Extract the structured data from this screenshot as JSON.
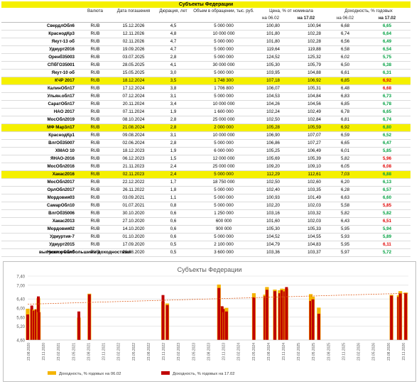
{
  "title": "Субъекты Федерации",
  "headers": {
    "currency": "Валюта",
    "maturity": "Дата погашения",
    "duration": "Дюрация, лет",
    "volume": "Объем в обращении, тыс. руб.",
    "price": "Цена, % от номинала",
    "yield": "Доходность, % годовых",
    "price_0602": "на 06.02",
    "price_1702": "на 17.02",
    "yield_0602": "на 06.02",
    "yield_1702": "на 17.02"
  },
  "colors": {
    "highlight": "#f5f000",
    "up": "#00a040",
    "down": "#e00000",
    "bar_0602": "#f4b400",
    "bar_1702": "#c00000",
    "trend": "#e06020"
  },
  "rows": [
    {
      "name": "СвердлОбл6",
      "cur": "RUB",
      "date": "15.12.2026",
      "dur": "4,5",
      "vol": "5 000 000",
      "p1": "100,80",
      "p2": "100,94",
      "y1": "6,68",
      "y2": "6,65",
      "dir": "up",
      "hl": false
    },
    {
      "name": "КраснодКр3",
      "cur": "RUB",
      "date": "12.11.2026",
      "dur": "4,8",
      "vol": "10 000 000",
      "p1": "101,80",
      "p2": "102,28",
      "y1": "6,74",
      "y2": "6,64",
      "dir": "up",
      "hl": false
    },
    {
      "name": "Якут-13 об",
      "cur": "RUB",
      "date": "02.11.2026",
      "dur": "4,7",
      "vol": "5 000 000",
      "p1": "101,80",
      "p2": "102,28",
      "y1": "6,56",
      "y2": "6,49",
      "dir": "up",
      "hl": false
    },
    {
      "name": "Удмурт2016",
      "cur": "RUB",
      "date": "19.09.2026",
      "dur": "4,7",
      "vol": "5 000 000",
      "p1": "119,64",
      "p2": "119,88",
      "y1": "6,58",
      "y2": "6,54",
      "dir": "up",
      "hl": false
    },
    {
      "name": "Оренб35003",
      "cur": "RUB",
      "date": "03.07.2025",
      "dur": "2,8",
      "vol": "5 000 000",
      "p1": "124,52",
      "p2": "125,32",
      "y1": "6,02",
      "y2": "5,75",
      "dir": "up",
      "hl": false
    },
    {
      "name": "СПбГО35001",
      "cur": "RUB",
      "date": "28.05.2025",
      "dur": "4,1",
      "vol": "30 000 000",
      "p1": "105,30",
      "p2": "105,79",
      "y1": "6,50",
      "y2": "6,38",
      "dir": "up",
      "hl": false
    },
    {
      "name": "Якут-10 об",
      "cur": "RUB",
      "date": "15.05.2025",
      "dur": "3,0",
      "vol": "5 000 000",
      "p1": "103,95",
      "p2": "104,88",
      "y1": "6,61",
      "y2": "6,31",
      "dir": "up",
      "hl": false
    },
    {
      "name": "КЧР 2017",
      "cur": "RUB",
      "date": "18.12.2024",
      "dur": "3,5",
      "vol": "1 748 300",
      "p1": "107,18",
      "p2": "106,92",
      "y1": "6,85",
      "y2": "6,92",
      "dir": "down",
      "hl": true
    },
    {
      "name": "КалинОбл17",
      "cur": "RUB",
      "date": "17.12.2024",
      "dur": "3,8",
      "vol": "1 706 800",
      "p1": "106,07",
      "p2": "105,31",
      "y1": "6,48",
      "y2": "6,68",
      "dir": "down",
      "hl": false
    },
    {
      "name": "Ульян.обл17",
      "cur": "RUB",
      "date": "07.12.2024",
      "dur": "3,1",
      "vol": "5 000 000",
      "p1": "104,53",
      "p2": "104,84",
      "y1": "6,83",
      "y2": "6,73",
      "dir": "up",
      "hl": false
    },
    {
      "name": "СаратОбл17",
      "cur": "RUB",
      "date": "20.11.2024",
      "dur": "3,4",
      "vol": "10 000 000",
      "p1": "104,26",
      "p2": "104,56",
      "y1": "6,85",
      "y2": "6,78",
      "dir": "up",
      "hl": false
    },
    {
      "name": "НАО 2017",
      "cur": "RUB",
      "date": "07.11.2024",
      "dur": "1,9",
      "vol": "1 600 000",
      "p1": "102,24",
      "p2": "102,49",
      "y1": "6,78",
      "y2": "6,65",
      "dir": "up",
      "hl": false
    },
    {
      "name": "МосОбл2019",
      "cur": "RUB",
      "date": "08.10.2024",
      "dur": "2,8",
      "vol": "25 000 000",
      "p1": "102,50",
      "p2": "102,84",
      "y1": "6,81",
      "y2": "6,74",
      "dir": "up",
      "hl": false
    },
    {
      "name": "МФ Мар3л17",
      "cur": "RUB",
      "date": "21.08.2024",
      "dur": "2,8",
      "vol": "2 000 000",
      "p1": "105,28",
      "p2": "105,59",
      "y1": "6,92",
      "y2": "6,80",
      "dir": "up",
      "hl": true
    },
    {
      "name": "КраснодКр1",
      "cur": "RUB",
      "date": "09.08.2024",
      "dur": "3,1",
      "vol": "10 000 000",
      "p1": "106,90",
      "p2": "107,07",
      "y1": "6,59",
      "y2": "6,52",
      "dir": "up",
      "hl": false
    },
    {
      "name": "ВлгОб35007",
      "cur": "RUB",
      "date": "02.06.2024",
      "dur": "2,8",
      "vol": "5 000 000",
      "p1": "106,86",
      "p2": "107,27",
      "y1": "6,65",
      "y2": "6,47",
      "dir": "up",
      "hl": false
    },
    {
      "name": "ХМАО 10",
      "cur": "RUB",
      "date": "18.12.2023",
      "dur": "1,9",
      "vol": "6 000 000",
      "p1": "105,25",
      "p2": "106,49",
      "y1": "6,01",
      "y2": "5,85",
      "dir": "up",
      "hl": false
    },
    {
      "name": "ЯНАО-2016",
      "cur": "RUB",
      "date": "06.12.2023",
      "dur": "1,5",
      "vol": "12 000 000",
      "p1": "105,69",
      "p2": "105,39",
      "y1": "5,82",
      "y2": "5,96",
      "dir": "down",
      "hl": false
    },
    {
      "name": "МосОбл2016",
      "cur": "RUB",
      "date": "21.11.2023",
      "dur": "2,4",
      "vol": "25 000 000",
      "p1": "109,20",
      "p2": "109,10",
      "y1": "6,05",
      "y2": "6,08",
      "dir": "down",
      "hl": false
    },
    {
      "name": "Хакас2016",
      "cur": "RUB",
      "date": "02.11.2023",
      "dur": "2,4",
      "vol": "5 000 000",
      "p1": "112,29",
      "p2": "112,61",
      "y1": "7,03",
      "y2": "6,88",
      "dir": "up",
      "hl": true
    },
    {
      "name": "МосОбл2017",
      "cur": "RUB",
      "date": "22.12.2022",
      "dur": "1,7",
      "vol": "18 750 000",
      "p1": "102,50",
      "p2": "102,60",
      "y1": "6,20",
      "y2": "6,13",
      "dir": "up",
      "hl": false
    },
    {
      "name": "ОрлОбл2017",
      "cur": "RUB",
      "date": "26.11.2022",
      "dur": "1,8",
      "vol": "5 000 000",
      "p1": "102,40",
      "p2": "103,35",
      "y1": "6,28",
      "y2": "6,57",
      "dir": "up",
      "hl": false
    },
    {
      "name": "Мордовия03",
      "cur": "RUB",
      "date": "03.09.2021",
      "dur": "1,1",
      "vol": "5 000 000",
      "p1": "100,93",
      "p2": "101,49",
      "y1": "6,63",
      "y2": "6,60",
      "dir": "up",
      "hl": false
    },
    {
      "name": "СамарОбл10",
      "cur": "RUB",
      "date": "01.07.2021",
      "dur": "0,8",
      "vol": "5 000 000",
      "p1": "102,20",
      "p2": "102,03",
      "y1": "5,58",
      "y2": "5,85",
      "dir": "down",
      "hl": false
    },
    {
      "name": "ВлгОб35006",
      "cur": "RUB",
      "date": "30.10.2020",
      "dur": "0,6",
      "vol": "1 250 000",
      "p1": "103,16",
      "p2": "103,32",
      "y1": "5,82",
      "y2": "5,82",
      "dir": "up",
      "hl": false
    },
    {
      "name": "Хакас2013",
      "cur": "RUB",
      "date": "27.10.2020",
      "dur": "0,6",
      "vol": "600 000",
      "p1": "101,60",
      "p2": "102,03",
      "y1": "6,43",
      "y2": "6,51",
      "dir": "down",
      "hl": false
    },
    {
      "name": "Мордовия02",
      "cur": "RUB",
      "date": "14.10.2020",
      "dur": "0,6",
      "vol": "900 000",
      "p1": "105,30",
      "p2": "105,33",
      "y1": "5,95",
      "y2": "5,94",
      "dir": "up",
      "hl": false
    },
    {
      "name": "Удмуртия-7",
      "cur": "RUB",
      "date": "01.10.2020",
      "dur": "0,6",
      "vol": "5 000 000",
      "p1": "104,52",
      "p2": "104,55",
      "y1": "5,93",
      "y2": "5,89",
      "dir": "up",
      "hl": false
    },
    {
      "name": "Удмурт2015",
      "cur": "RUB",
      "date": "17.09.2020",
      "dur": "0,5",
      "vol": "2 100 000",
      "p1": "104,79",
      "p2": "104,83",
      "y1": "5,95",
      "y2": "6,11",
      "dir": "down",
      "hl": false
    },
    {
      "name": "НижгорОбл0",
      "cur": "RUB",
      "date": "23.08.2020",
      "dur": "0,5",
      "vol": "3 600 000",
      "p1": "103,36",
      "p2": "103,37",
      "y1": "5,97",
      "y2": "5,72",
      "dir": "up",
      "hl": false
    }
  ],
  "footnote": "выпуски с наибольшими доходностями",
  "chart_data": {
    "type": "bar",
    "title": "Субъекты Федерации",
    "ylim": [
      4.6,
      7.4
    ],
    "yticks": [
      "4,60",
      "5,20",
      "5,60",
      "6,00",
      "6,40",
      "7,00",
      "7,40"
    ],
    "xticks": [
      "23.08.2020",
      "23.11.2020",
      "23.02.2021",
      "23.05.2021",
      "23.08.2021",
      "23.11.2021",
      "23.02.2022",
      "23.05.2022",
      "23.08.2022",
      "23.11.2022",
      "23.02.2023",
      "23.05.2023",
      "23.08.2023",
      "23.11.2023",
      "23.02.2024",
      "23.05.2024",
      "23.08.2024",
      "23.11.2024",
      "23.02.2025",
      "23.05.2025",
      "23.08.2025",
      "23.11.2025",
      "23.02.2026",
      "23.05.2026",
      "23.08.2026",
      "23.11.2026"
    ],
    "x": [
      "2020-08-23",
      "2020-09-17",
      "2020-10-01",
      "2020-10-14",
      "2020-10-27",
      "2020-10-30",
      "2021-07-01",
      "2021-09-03",
      "2022-11-26",
      "2022-12-22",
      "2023-11-02",
      "2023-11-21",
      "2023-12-06",
      "2023-12-18",
      "2024-06-02",
      "2024-08-09",
      "2024-08-21",
      "2024-10-08",
      "2024-11-07",
      "2024-11-20",
      "2024-12-07",
      "2024-12-17",
      "2024-12-18",
      "2025-05-15",
      "2025-05-28",
      "2025-07-03",
      "2026-09-19",
      "2026-11-02",
      "2026-11-12",
      "2026-12-15"
    ],
    "series": [
      {
        "name": "Доходность, % годовых на 06.02",
        "color": "#f4b400",
        "values": [
          5.97,
          5.95,
          5.93,
          5.95,
          6.43,
          5.82,
          5.58,
          6.63,
          6.28,
          6.2,
          7.03,
          6.05,
          5.82,
          6.01,
          6.65,
          6.59,
          6.92,
          6.81,
          6.78,
          6.85,
          6.83,
          6.48,
          6.85,
          6.61,
          6.5,
          6.02,
          6.58,
          6.56,
          6.74,
          6.68
        ]
      },
      {
        "name": "Доходность, % годовых на 17.02",
        "color": "#c00000",
        "values": [
          5.72,
          6.11,
          5.89,
          5.94,
          6.51,
          5.82,
          5.85,
          6.6,
          6.57,
          6.13,
          6.88,
          6.08,
          5.96,
          5.85,
          6.47,
          6.52,
          6.8,
          6.74,
          6.65,
          6.78,
          6.73,
          6.68,
          6.92,
          6.31,
          6.38,
          5.75,
          6.54,
          6.49,
          6.64,
          6.65
        ]
      }
    ],
    "trendline": {
      "start": 6.17,
      "end": 6.65
    },
    "legend": "bottom",
    "grid": true
  }
}
